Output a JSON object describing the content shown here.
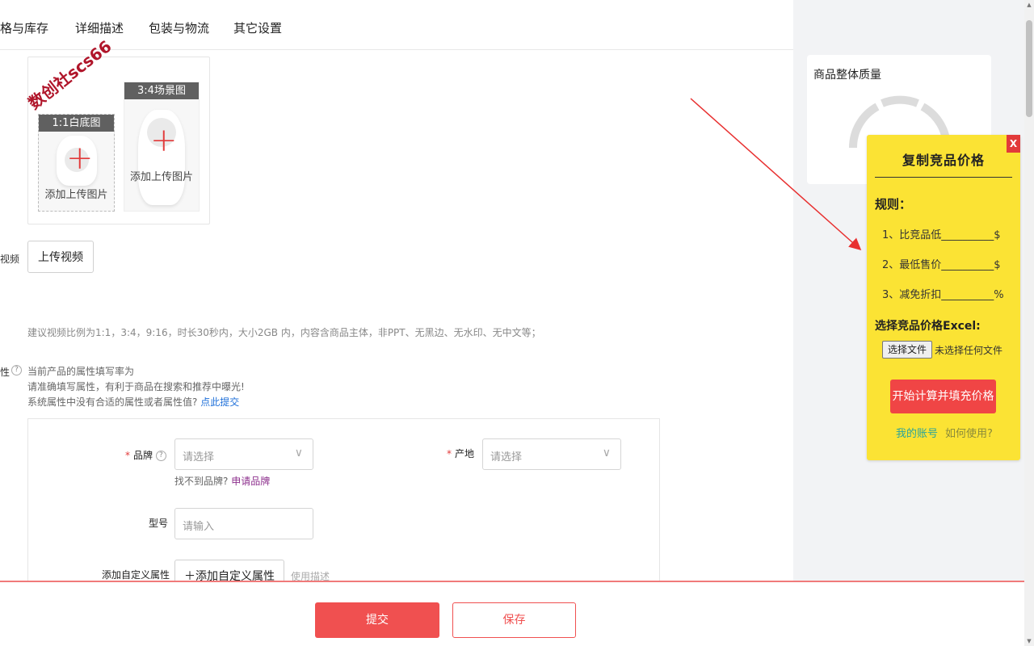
{
  "tabs": [
    {
      "label": "格与库存"
    },
    {
      "label": "详细描述"
    },
    {
      "label": "包装与物流"
    },
    {
      "label": "其它设置"
    }
  ],
  "watermark": "数创社scs66",
  "images": {
    "slot1_tag": "1:1白底图",
    "slot1_caption": "添加上传图片",
    "slot2_tag": "3:4场景图",
    "slot2_caption": "添加上传图片"
  },
  "video": {
    "label": "视频",
    "button": "上传视频",
    "hint": "建议视频比例为1:1，3:4，9:16，时长30秒内，大小2GB 内，内容含商品主体，非PPT、无黑边、无水印、无中文等；"
  },
  "attributes": {
    "label": "性",
    "line1": "当前产品的属性填写率为",
    "line2": "请准确填写属性，有利于商品在搜索和推荐中曝光!",
    "line3": "系统属性中没有合适的属性或者属性值?",
    "submit_link": "点此提交",
    "brand_label": "品牌",
    "brand_placeholder": "请选择",
    "brand_note": "找不到品牌?",
    "brand_apply": "申请品牌",
    "origin_label": "产地",
    "origin_placeholder": "请选择",
    "model_label": "型号",
    "model_placeholder": "请输入",
    "custom_label": "添加自定义属性",
    "custom_button": "添加自定义属性",
    "usage_hint": "使用描述"
  },
  "footer": {
    "submit": "提交",
    "save": "保存"
  },
  "quality": {
    "title": "商品整体质量"
  },
  "panel": {
    "close": "X",
    "title": "复制竞品价格",
    "rules_title": "规则：",
    "rule1": "1、比竞品低__________$",
    "rule2": "2、最低售价__________$",
    "rule3": "3、减免折扣__________%",
    "excel_title": "选择竞品价格Excel:",
    "file_button": "选择文件",
    "file_status": "未选择任何文件",
    "calc_button": "开始计算并填充价格",
    "account_link": "我的账号",
    "howto_link": "如何使用?"
  },
  "colors": {
    "panel_bg": "#fbe334",
    "accent_red": "#f05050",
    "link_blue": "#1e6fd9"
  }
}
